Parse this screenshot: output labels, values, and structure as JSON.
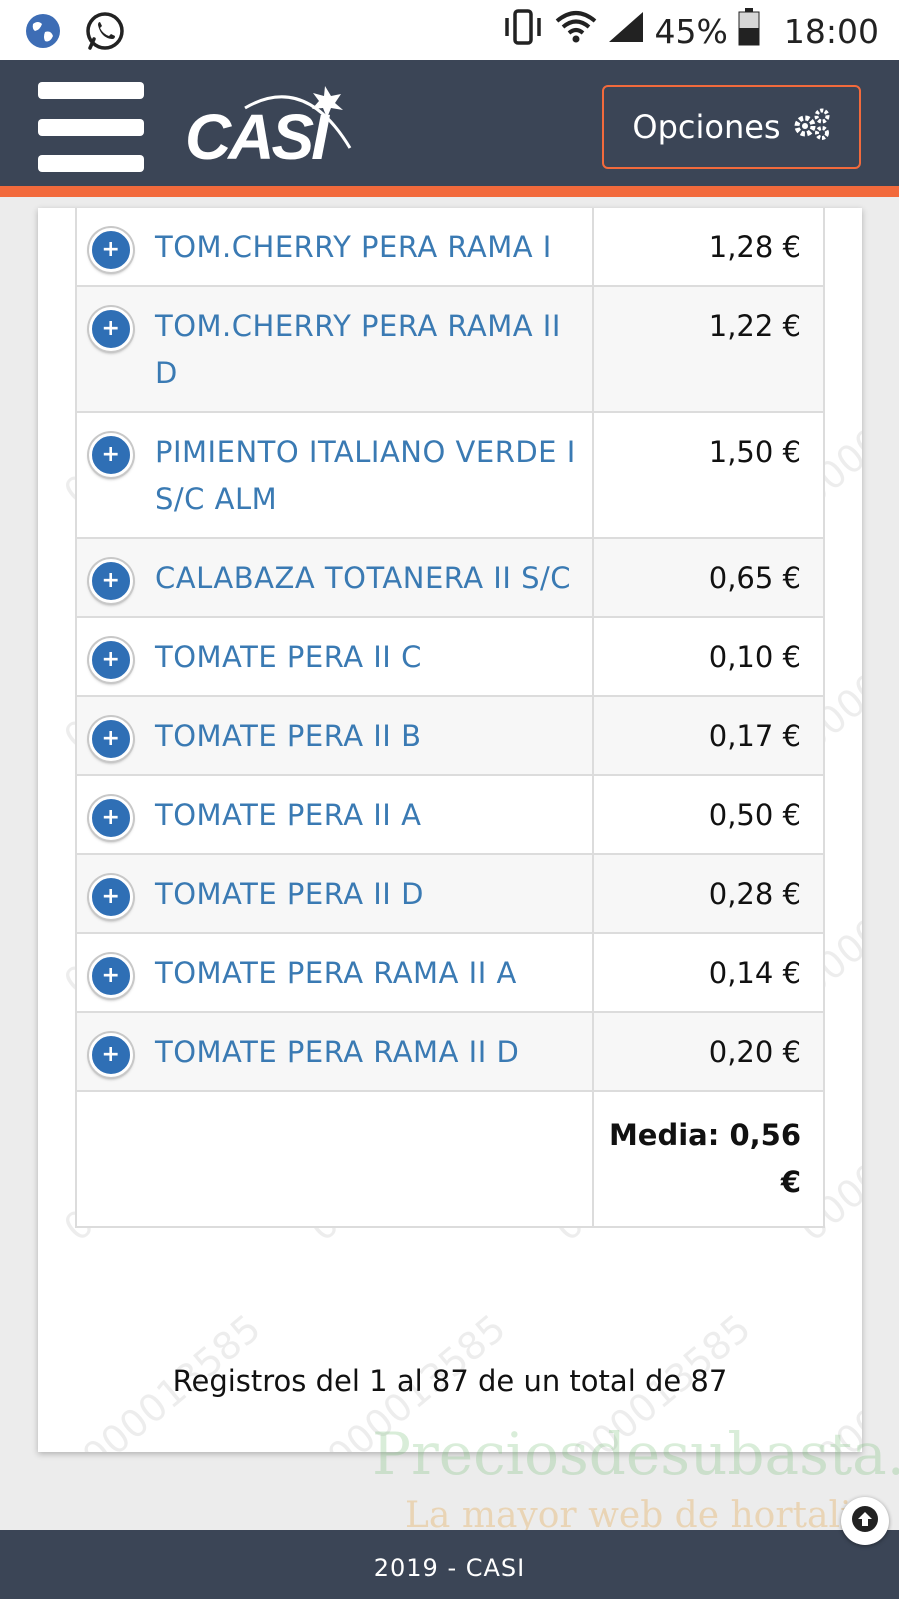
{
  "status_bar": {
    "left_icons": [
      "globe-icon",
      "whatsapp-icon"
    ],
    "right_icons": [
      "vibrate-icon",
      "wifi-icon",
      "signal-icon",
      "battery-icon"
    ],
    "battery": "45%",
    "time": "18:00"
  },
  "header": {
    "logo_text": "CASI",
    "options_label": "Opciones",
    "options_icon": "gears-icon",
    "menu_icon": "hamburger-icon",
    "background": "#3b4556",
    "accent": "#f26a3c"
  },
  "table": {
    "rows": [
      {
        "name": "TOM.CHERRY PERA RAMA I",
        "price": "1,28 €"
      },
      {
        "name": "TOM.CHERRY PERA RAMA II D",
        "price": "1,22 €"
      },
      {
        "name": "PIMIENTO ITALIANO VERDE I S/C ALM",
        "price": "1,50 €"
      },
      {
        "name": "CALABAZA TOTANERA II S/C",
        "price": "0,65 €"
      },
      {
        "name": "TOMATE PERA II C",
        "price": "0,10 €"
      },
      {
        "name": "TOMATE PERA II B",
        "price": "0,17 €"
      },
      {
        "name": "TOMATE PERA II A",
        "price": "0,50 €"
      },
      {
        "name": "TOMATE PERA II D",
        "price": "0,28 €"
      },
      {
        "name": "TOMATE PERA RAMA II A",
        "price": "0,14 €"
      },
      {
        "name": "TOMATE PERA RAMA II D",
        "price": "0,20 €"
      }
    ],
    "total_label": "Media: 0,56 €",
    "expand_icon": "plus-circle-icon",
    "row_text_color": "#3a7ab3"
  },
  "registros": "Registros del 1 al 87 de un total de 87",
  "watermark": "0000013585",
  "overlay": {
    "brand": "Preciosdesubasta.com",
    "tagline": "La mayor web de hortaliz"
  },
  "footer": {
    "text": "2019 - CASI",
    "scroll_top_icon": "arrow-up-circle-icon"
  }
}
